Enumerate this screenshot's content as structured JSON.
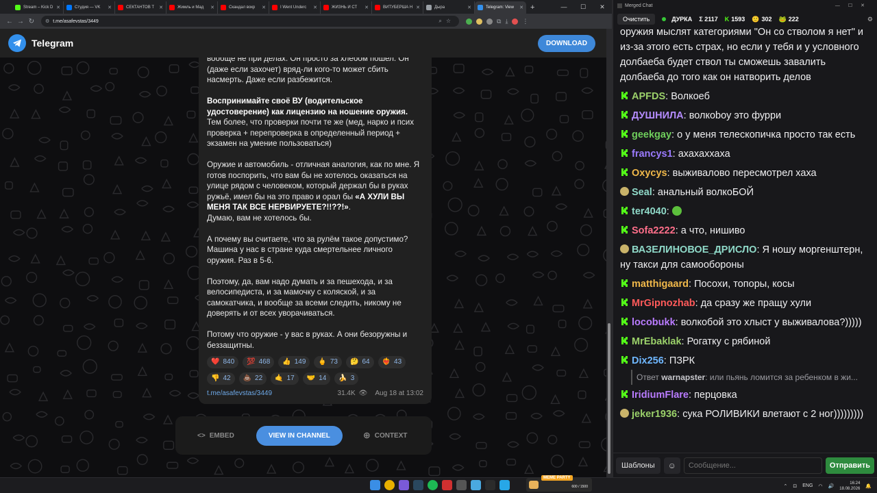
{
  "browser": {
    "tabs": [
      {
        "label": "Stream – Kick D",
        "color": "#53fc18"
      },
      {
        "label": "Студия — VK",
        "color": "#0077ff"
      },
      {
        "label": "СЕКТАНТОВ Т",
        "color": "#ff0000"
      },
      {
        "label": "Жимль и Мад",
        "color": "#ff0000"
      },
      {
        "label": "Скандал вокр",
        "color": "#ff0000"
      },
      {
        "label": "I Went Underc",
        "color": "#ff0000"
      },
      {
        "label": "ЖИЗНЬ И СТ",
        "color": "#ff0000"
      },
      {
        "label": "ВИТУБЕРША Н",
        "color": "#ff0000"
      },
      {
        "label": "Дыра",
        "color": "#9aa0a6"
      },
      {
        "label": "Telegram: View",
        "color": "#3390ec",
        "active": true
      }
    ],
    "url": "t.me/asafevstas/3449"
  },
  "telegram": {
    "brand": "Telegram",
    "download": "DOWNLOAD",
    "post": {
      "p0": "вообще не при делах. Он просто за хлебом пошел. Он (даже если захочет) вряд-ли кого-то может сбить насмерть. Даже если разбежится.",
      "p1_bold": "Воспринимайте своё ВУ (водительское удостоверение) как лицензию на ношение оружия.",
      "p1_rest": "Тем более, что проверки почти те же (мед, нарко и псих проверка + перепроверка в определенный период + экзамен на умение пользоваться)",
      "p2_a": "Оружие и автомобиль - отличная аналогия, как по мне. Я готов поспорить, что вам бы не хотелось оказаться на улице рядом с человеком, который держал бы в руках ружьё, имел бы на это право и орал бы ",
      "p2_bold": "«А ХУЛИ ВЫ МЕНЯ ТАК ВСЕ НЕРВИРУЕТЕ?!!??!»",
      "p2_b": ".",
      "p2_c": "Думаю, вам не хотелось бы.",
      "p3": "А почему вы считаете, что за рулём такое допустимо? Машина у нас в стране куда смертельнее личного оружия. Раз в 5-6.",
      "p4": "Поэтому, да, вам надо думать и за пешехода, и за велосипедиста, и за мамочку с коляской, и за самокатчика, и вообще за всеми следить, никому не доверять и от всех уворачиваться.",
      "p5": "Потому что оружие - у вас в руках. А они безоружны и беззащитны."
    },
    "reactions": [
      {
        "emoji": "❤️",
        "count": "840"
      },
      {
        "emoji": "💯",
        "count": "468"
      },
      {
        "emoji": "👍",
        "count": "149"
      },
      {
        "emoji": "🖕",
        "count": "73"
      },
      {
        "emoji": "🤔",
        "count": "64"
      },
      {
        "emoji": "❤️‍🔥",
        "count": "43"
      },
      {
        "emoji": "👎",
        "count": "42"
      },
      {
        "emoji": "💩",
        "count": "22"
      },
      {
        "emoji": "🤙",
        "count": "17"
      },
      {
        "emoji": "🤝",
        "count": "14"
      },
      {
        "emoji": "🍌",
        "count": "3"
      }
    ],
    "link": "t.me/asafevstas/3449",
    "views": "31.4K",
    "date": "Aug 18 at 13:02",
    "embed": "EMBED",
    "view_channel": "VIEW IN CHANNEL",
    "context": "CONTEXT"
  },
  "chat": {
    "window_title": "Merged Chat",
    "clear": "Очистить",
    "streamer": "ДУРКА",
    "total": "Σ 2117",
    "kick": "1593",
    "twitch": "302",
    "other": "222",
    "partial_message": "оружия мыслят категориями \"Он со стволом я нет\" и из-за этого есть страх, но если у тебя и у условного долбаеба будет ствол ты сможешь завалить долбаеба до того как он натворить делов",
    "messages": [
      {
        "user": "APFDS",
        "color": "#9bd16a",
        "text": "Волкоеб"
      },
      {
        "user": "ДУШНИЛА",
        "color": "#b58cff",
        "text": "волкоboy это фурри"
      },
      {
        "user": "geekgay",
        "color": "#6fcf5c",
        "text": "о у меня телескопичка просто так есть"
      },
      {
        "user": "francys1",
        "color": "#9b7bff",
        "text": "ахахаххаха"
      },
      {
        "user": "Oxycys",
        "color": "#f0b84a",
        "text": "выживалово пересмотрел хаха"
      },
      {
        "user": "Seal",
        "color": "#8fd9c8",
        "text": "анальный волкоБОЙ",
        "badge": "avatar"
      },
      {
        "user": "ter4040",
        "color": "#8fd9c8",
        "text": "",
        "emote": true
      },
      {
        "user": "Sofa2222",
        "color": "#ff6f8a",
        "text": "а что, нишиво"
      },
      {
        "user": "ВАЗЕЛИНОВОЕ_ДРИСЛО",
        "color": "#8fd9c8",
        "text": "Я ношу моргенштерн, ну такси для самообороны",
        "badge": "avatar"
      },
      {
        "user": "matthigaard",
        "color": "#f0b84a",
        "text": "Посохи, топоры, косы"
      },
      {
        "user": "MrGipnozhab",
        "color": "#ff5a5a",
        "text": "да сразу же пращу хули"
      },
      {
        "user": "locobukk",
        "color": "#b97bff",
        "text": "волкобой это хлыст у выживалова?)))))"
      },
      {
        "user": "MrEbaklak",
        "color": "#9bd16a",
        "text": "Рогатку с рябиной"
      },
      {
        "user": "Dix256",
        "color": "#6fb7ff",
        "text": "ПЗРК"
      },
      {
        "user": "IridiumFlare",
        "color": "#b97bff",
        "text": "перцовка"
      },
      {
        "user": "jeker1936",
        "color": "#9bd16a",
        "text": "сука РОЛИВИКИ влетают с 2 ног)))))))))",
        "badge": "avatar"
      }
    ],
    "reply_prefix": "Ответ",
    "reply_user": "warnapster",
    "reply_text": "или пьянь ломится за ребенком в жи...",
    "templates": "Шаблоны",
    "placeholder": "Сообщение...",
    "send": "Отправить"
  },
  "taskbar": {
    "stream_title": "MEME PARTY",
    "stream_count": "600 / 1500",
    "lang": "ENG",
    "time": "16:24",
    "date": "18.08.2026"
  }
}
